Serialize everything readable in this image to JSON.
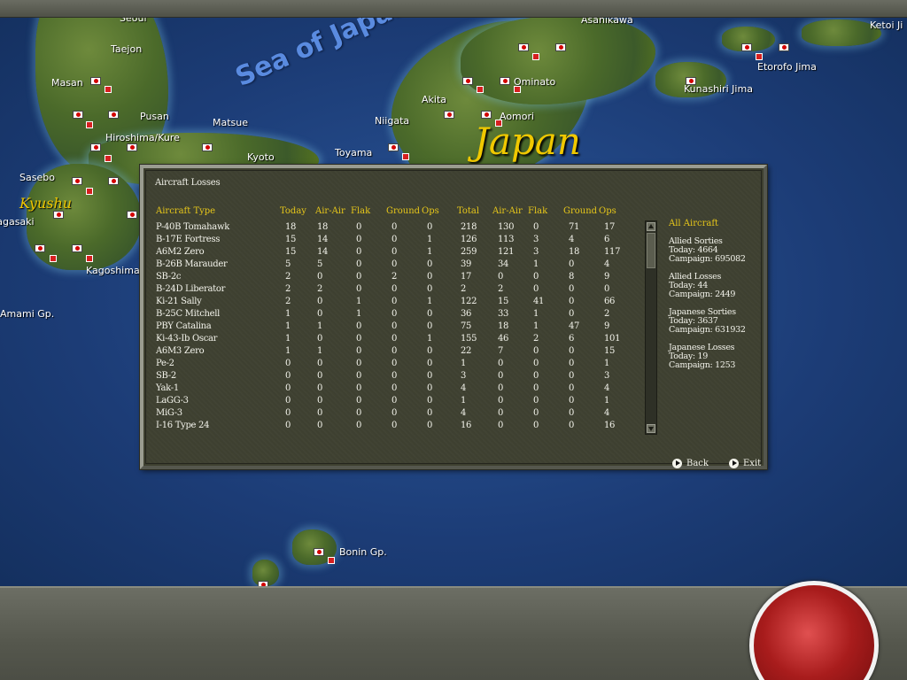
{
  "map": {
    "sea_label": "Sea of Japan",
    "country_label": "Japan",
    "region_label": "Kyushu",
    "places": [
      "Taejon",
      "Masan",
      "Pusan",
      "Matsue",
      "Niigata",
      "Akita",
      "Ominato",
      "Aomori",
      "Asahikawa",
      "Etorofo Jima",
      "Kunashiri Jima",
      "Ketoi Ji",
      "Hiroshima/Kure",
      "Kyoto",
      "Toyama",
      "Sasebo",
      "Nagasaki",
      "Kagoshima",
      "Amami Gp.",
      "Bonin Gp.",
      "Seoul"
    ]
  },
  "dialog": {
    "title": "Aircraft Losses",
    "headers": [
      "Aircraft Type",
      "Today",
      "Air-Air",
      "Flak",
      "Ground",
      "Ops",
      "Total",
      "Air-Air",
      "Flak",
      "Ground",
      "Ops"
    ],
    "rows": [
      [
        "P-40B Tomahawk",
        "18",
        "18",
        "0",
        "0",
        "0",
        "218",
        "130",
        "0",
        "71",
        "17"
      ],
      [
        "B-17E Fortress",
        "15",
        "14",
        "0",
        "0",
        "1",
        "126",
        "113",
        "3",
        "4",
        "6"
      ],
      [
        "A6M2 Zero",
        "15",
        "14",
        "0",
        "0",
        "1",
        "259",
        "121",
        "3",
        "18",
        "117"
      ],
      [
        "B-26B Marauder",
        "5",
        "5",
        "0",
        "0",
        "0",
        "39",
        "34",
        "1",
        "0",
        "4"
      ],
      [
        "SB-2c",
        "2",
        "0",
        "0",
        "2",
        "0",
        "17",
        "0",
        "0",
        "8",
        "9"
      ],
      [
        "B-24D Liberator",
        "2",
        "2",
        "0",
        "0",
        "0",
        "2",
        "2",
        "0",
        "0",
        "0"
      ],
      [
        "Ki-21 Sally",
        "2",
        "0",
        "1",
        "0",
        "1",
        "122",
        "15",
        "41",
        "0",
        "66"
      ],
      [
        "B-25C Mitchell",
        "1",
        "0",
        "1",
        "0",
        "0",
        "36",
        "33",
        "1",
        "0",
        "2"
      ],
      [
        "PBY Catalina",
        "1",
        "1",
        "0",
        "0",
        "0",
        "75",
        "18",
        "1",
        "47",
        "9"
      ],
      [
        "Ki-43-Ib Oscar",
        "1",
        "0",
        "0",
        "0",
        "1",
        "155",
        "46",
        "2",
        "6",
        "101"
      ],
      [
        "A6M3 Zero",
        "1",
        "1",
        "0",
        "0",
        "0",
        "22",
        "7",
        "0",
        "0",
        "15"
      ],
      [
        "Pe-2",
        "0",
        "0",
        "0",
        "0",
        "0",
        "1",
        "0",
        "0",
        "0",
        "1"
      ],
      [
        "SB-2",
        "0",
        "0",
        "0",
        "0",
        "0",
        "3",
        "0",
        "0",
        "0",
        "3"
      ],
      [
        "Yak-1",
        "0",
        "0",
        "0",
        "0",
        "0",
        "4",
        "0",
        "0",
        "0",
        "4"
      ],
      [
        "LaGG-3",
        "0",
        "0",
        "0",
        "0",
        "0",
        "1",
        "0",
        "0",
        "0",
        "1"
      ],
      [
        "MiG-3",
        "0",
        "0",
        "0",
        "0",
        "0",
        "4",
        "0",
        "0",
        "0",
        "4"
      ],
      [
        "I-16 Type 24",
        "0",
        "0",
        "0",
        "0",
        "0",
        "16",
        "0",
        "0",
        "0",
        "16"
      ]
    ],
    "summary": {
      "heading": "All Aircraft",
      "blocks": [
        {
          "title": "Allied Sorties",
          "today": "Today:   4664",
          "campaign": "Campaign: 695082"
        },
        {
          "title": "Allied Losses",
          "today": "Today:   44",
          "campaign": "Campaign: 2449"
        },
        {
          "title": "Japanese Sorties",
          "today": "Today:   3637",
          "campaign": "Campaign: 631932"
        },
        {
          "title": "Japanese Losses",
          "today": "Today:   19",
          "campaign": "Campaign: 1253"
        }
      ]
    },
    "back_label": "Back",
    "exit_label": "Exit"
  }
}
